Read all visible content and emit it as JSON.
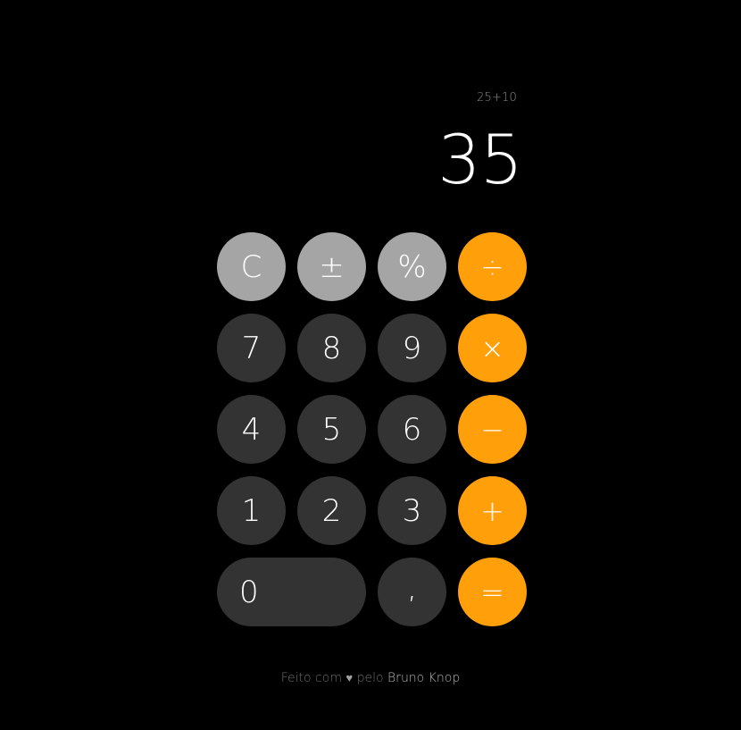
{
  "display": {
    "expression": "25+10",
    "result": "35"
  },
  "keys": {
    "clear": "C",
    "sign": "±",
    "percent": "%",
    "divide": "÷",
    "seven": "7",
    "eight": "8",
    "nine": "9",
    "multiply": "×",
    "four": "4",
    "five": "5",
    "six": "6",
    "minus": "−",
    "one": "1",
    "two": "2",
    "three": "3",
    "plus": "+",
    "zero": "0",
    "comma": ",",
    "equals": "="
  },
  "footer": {
    "prefix": "Feito com",
    "heart": "♥",
    "middle": "pelo",
    "author": "Bruno Knop"
  },
  "colors": {
    "background": "#000000",
    "function_key": "#a5a5a5",
    "number_key": "#333333",
    "operator_key": "#ff9f0a"
  }
}
